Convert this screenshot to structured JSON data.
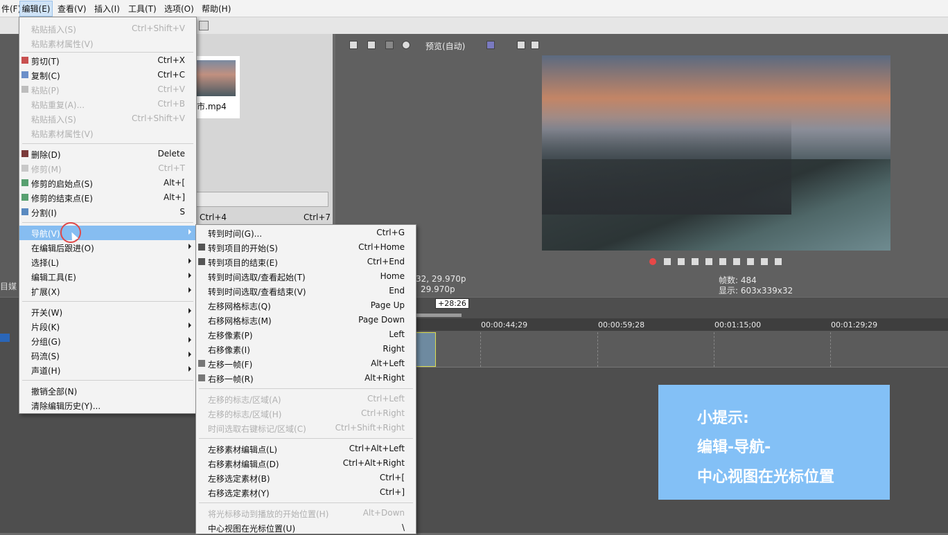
{
  "menubar": [
    "件(F)",
    "编辑(E)",
    "查看(V)",
    "插入(I)",
    "工具(T)",
    "选项(O)",
    "帮助(H)"
  ],
  "edit_menu": {
    "items": [
      {
        "label": "粘贴插入(S)",
        "shortcut": "Ctrl+Shift+V",
        "disabled": true
      },
      {
        "label": "粘贴素材属性(V)",
        "shortcut": "",
        "disabled": true
      },
      {
        "label": "剪切(T)",
        "shortcut": "Ctrl+X",
        "disabled": false,
        "icon": "scissors-icon"
      },
      {
        "label": "复制(C)",
        "shortcut": "Ctrl+C",
        "disabled": false,
        "icon": "copy-icon"
      },
      {
        "label": "粘贴(P)",
        "shortcut": "Ctrl+V",
        "disabled": true,
        "icon": "paste-icon"
      },
      {
        "label": "粘贴重复(A)...",
        "shortcut": "Ctrl+B",
        "disabled": true
      },
      {
        "label": "粘贴插入(S)",
        "shortcut": "Ctrl+Shift+V",
        "disabled": true
      },
      {
        "label": "粘贴素材属性(V)",
        "shortcut": "",
        "disabled": true
      },
      {
        "label": "删除(D)",
        "shortcut": "Delete",
        "disabled": false,
        "icon": "delete-icon"
      },
      {
        "label": "修剪(M)",
        "shortcut": "Ctrl+T",
        "disabled": true,
        "icon": "trim-icon"
      },
      {
        "label": "修剪的启始点(S)",
        "shortcut": "Alt+[",
        "disabled": false,
        "icon": "trim-start-icon"
      },
      {
        "label": "修剪的结束点(E)",
        "shortcut": "Alt+]",
        "disabled": false,
        "icon": "trim-end-icon"
      },
      {
        "label": "分割(I)",
        "shortcut": "S",
        "disabled": false,
        "icon": "split-icon"
      },
      {
        "label": "导航(V)",
        "submenu": true,
        "highlighted": true
      },
      {
        "label": "在编辑后跟进(O)",
        "submenu": true
      },
      {
        "label": "选择(L)",
        "submenu": true
      },
      {
        "label": "编辑工具(E)",
        "submenu": true
      },
      {
        "label": "扩展(X)",
        "submenu": true
      },
      {
        "label": "开关(W)",
        "submenu": true
      },
      {
        "label": "片段(K)",
        "submenu": true
      },
      {
        "label": "分组(G)",
        "submenu": true
      },
      {
        "label": "码流(S)",
        "submenu": true
      },
      {
        "label": "声道(H)",
        "submenu": true
      },
      {
        "label": "撤销全部(N)",
        "shortcut": ""
      },
      {
        "label": "清除编辑历史(Y)...",
        "shortcut": ""
      }
    ]
  },
  "nav_submenu": {
    "items": [
      {
        "label": "转到时间(G)...",
        "shortcut": "Ctrl+G"
      },
      {
        "label": "转到项目的开始(S)",
        "shortcut": "Ctrl+Home",
        "icon": "go-start-icon"
      },
      {
        "label": "转到项目的结束(E)",
        "shortcut": "Ctrl+End",
        "icon": "go-end-icon"
      },
      {
        "label": "转到时间选取/查看起始(T)",
        "shortcut": "Home"
      },
      {
        "label": "转到时间选取/查看结束(V)",
        "shortcut": "End"
      },
      {
        "label": "左移网格标志(Q)",
        "shortcut": "Page Up"
      },
      {
        "label": "右移网格标志(M)",
        "shortcut": "Page Down"
      },
      {
        "label": "左移像素(P)",
        "shortcut": "Left"
      },
      {
        "label": "右移像素(I)",
        "shortcut": "Right"
      },
      {
        "label": "左移一帧(F)",
        "shortcut": "Alt+Left",
        "icon": "frame-left-icon"
      },
      {
        "label": "右移一帧(R)",
        "shortcut": "Alt+Right",
        "icon": "frame-right-icon"
      },
      {
        "label": "左移的标志/区域(A)",
        "shortcut": "Ctrl+Left",
        "disabled": true
      },
      {
        "label": "左移的标志/区域(H)",
        "shortcut": "Ctrl+Right",
        "disabled": true
      },
      {
        "label": "时间选取右键标记/区域(C)",
        "shortcut": "Ctrl+Shift+Right",
        "disabled": true
      },
      {
        "label": "左移素材编辑点(L)",
        "shortcut": "Ctrl+Alt+Left"
      },
      {
        "label": "右移素材编辑点(D)",
        "shortcut": "Ctrl+Alt+Right"
      },
      {
        "label": "左移选定素材(B)",
        "shortcut": "Ctrl+["
      },
      {
        "label": "右移选定素材(Y)",
        "shortcut": "Ctrl+]"
      },
      {
        "label": "将光标移动到播放的开始位置(H)",
        "shortcut": "Alt+Down",
        "disabled": true
      },
      {
        "label": "中心视图在光标位置(U)",
        "shortcut": "\\"
      }
    ]
  },
  "preview": {
    "quality_label": "预览(自动)",
    "info_left_1": "32, 29.970p",
    "info_left_2": "29.970p",
    "frame_count": "帧数: 484",
    "display": "显示: 603x339x32"
  },
  "media": {
    "filename": "市.mp4",
    "shortcut_left": "Ctrl+4",
    "shortcut_right": "Ctrl+7"
  },
  "left_pane": {
    "tab_label": "目媒"
  },
  "timeline": {
    "marker_label": "+28:26",
    "timecodes": [
      "00:00:44;29",
      "00:00:59;28",
      "00:01:15;00",
      "00:01:29;29"
    ]
  },
  "tip": {
    "line1": "小提示:",
    "line2": "编辑-导航-",
    "line3": "中心视图在光标位置"
  },
  "colors": {
    "highlight": "#86bdf1",
    "tip_bg": "#83c0f6",
    "cursor_ring": "#e04848"
  }
}
